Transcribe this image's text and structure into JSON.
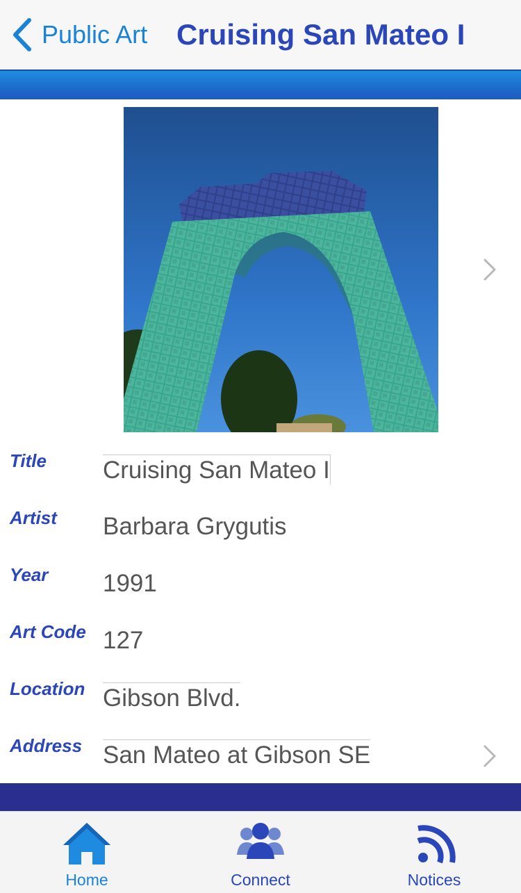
{
  "nav": {
    "back_label": "Public Art",
    "title": "Cruising San Mateo I"
  },
  "photo": {
    "icon": "image-of-artwork"
  },
  "details": [
    {
      "label": "Title",
      "value": "Cruising San Mateo I"
    },
    {
      "label": "Artist",
      "value": "Barbara Grygutis"
    },
    {
      "label": "Year",
      "value": "1991"
    },
    {
      "label": "Art Code",
      "value": "127"
    },
    {
      "label": "Location",
      "value": "Gibson Blvd."
    },
    {
      "label": "Address",
      "value": "San Mateo at Gibson SE"
    }
  ],
  "tabs": [
    {
      "label": "Home",
      "icon": "home-icon",
      "active": true
    },
    {
      "label": "Connect",
      "icon": "people-icon",
      "active": false
    },
    {
      "label": "Notices",
      "icon": "rss-icon",
      "active": false
    }
  ],
  "colors": {
    "accent": "#1a83d6",
    "title": "#2a46b8",
    "band": "#2a2f8f"
  }
}
